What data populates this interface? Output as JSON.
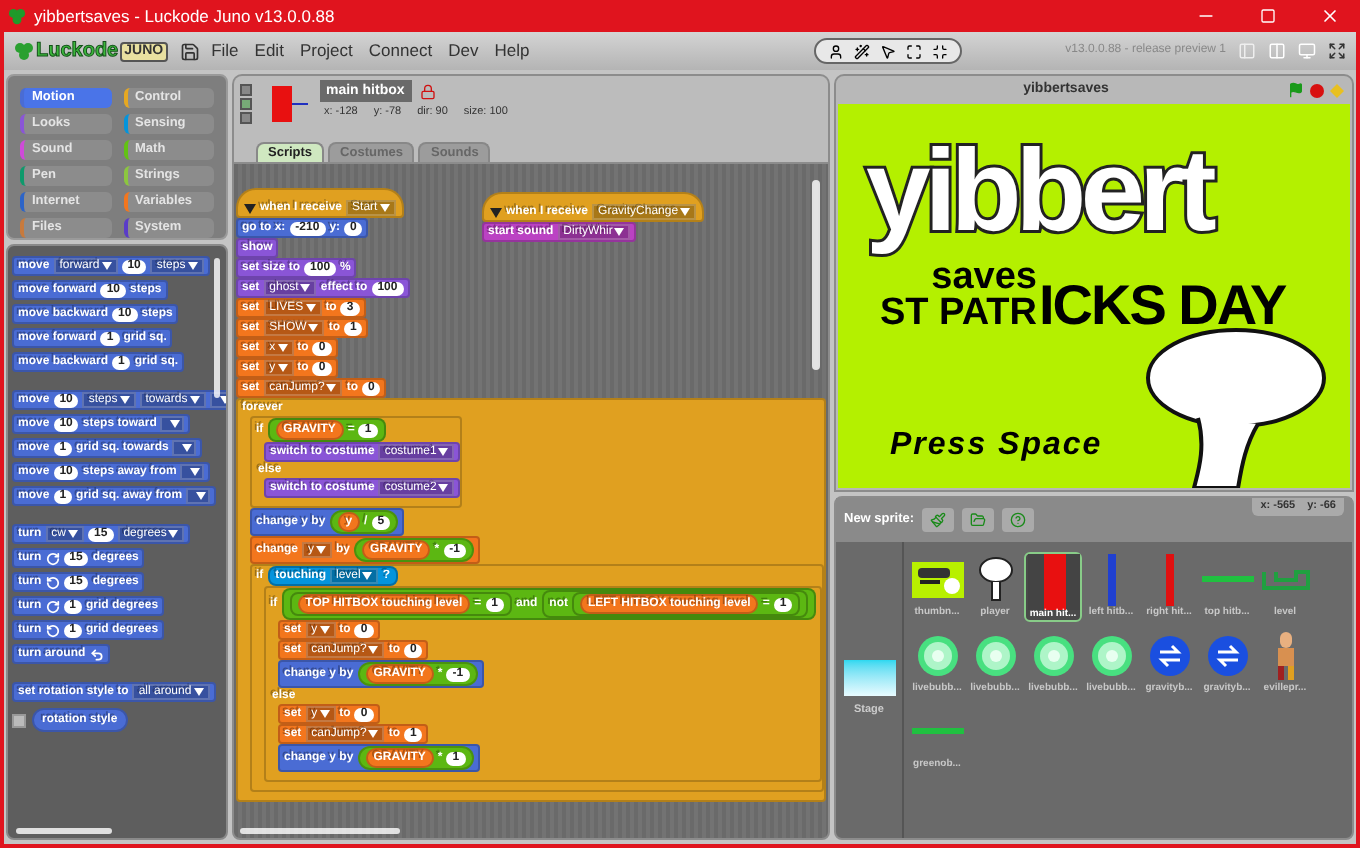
{
  "window": {
    "title": "yibbertsaves - Luckode Juno v13.0.0.88"
  },
  "logo": {
    "word": "Luckode",
    "badge": "JUNO"
  },
  "menu": [
    "File",
    "Edit",
    "Project",
    "Connect",
    "Dev",
    "Help"
  ],
  "version": "v13.0.0.88 - release preview 1",
  "categories": [
    {
      "label": "Motion",
      "color": "#4a6cd4",
      "selected": true
    },
    {
      "label": "Control",
      "color": "#e6a822",
      "selected": false
    },
    {
      "label": "Looks",
      "color": "#8a55d7",
      "selected": false
    },
    {
      "label": "Sensing",
      "color": "#0494dc",
      "selected": false
    },
    {
      "label": "Sound",
      "color": "#cf4ad9",
      "selected": false
    },
    {
      "label": "Math",
      "color": "#62c213",
      "selected": false
    },
    {
      "label": "Pen",
      "color": "#0e9a6c",
      "selected": false
    },
    {
      "label": "Strings",
      "color": "#8cc63f",
      "selected": false
    },
    {
      "label": "Internet",
      "color": "#2c64c8",
      "selected": false
    },
    {
      "label": "Variables",
      "color": "#f3761d",
      "selected": false
    },
    {
      "label": "Files",
      "color": "#c87a3c",
      "selected": false
    },
    {
      "label": "System",
      "color": "#5a3cc8",
      "selected": false
    }
  ],
  "palette": {
    "blocks": [
      {
        "kind": "motion",
        "parts": [
          {
            "kind": "text",
            "text": "move"
          },
          {
            "kind": "menu",
            "text": "forward"
          },
          {
            "kind": "num",
            "text": "10"
          },
          {
            "kind": "menu",
            "text": "steps"
          }
        ]
      },
      {
        "kind": "motion",
        "parts": [
          {
            "kind": "text",
            "text": "move forward"
          },
          {
            "kind": "num",
            "text": "10"
          },
          {
            "kind": "text",
            "text": "steps"
          }
        ]
      },
      {
        "kind": "motion",
        "parts": [
          {
            "kind": "text",
            "text": "move backward"
          },
          {
            "kind": "num",
            "text": "10"
          },
          {
            "kind": "text",
            "text": "steps"
          }
        ]
      },
      {
        "kind": "motion",
        "parts": [
          {
            "kind": "text",
            "text": "move forward"
          },
          {
            "kind": "num",
            "text": "1"
          },
          {
            "kind": "text",
            "text": "grid sq."
          }
        ]
      },
      {
        "kind": "motion",
        "parts": [
          {
            "kind": "text",
            "text": "move backward"
          },
          {
            "kind": "num",
            "text": "1"
          },
          {
            "kind": "text",
            "text": "grid sq."
          }
        ]
      },
      {
        "kind": "motion",
        "gap": true,
        "parts": [
          {
            "kind": "text",
            "text": "move"
          },
          {
            "kind": "num",
            "text": "10"
          },
          {
            "kind": "menu",
            "text": "steps"
          },
          {
            "kind": "menu",
            "text": "towards"
          },
          {
            "kind": "blank"
          }
        ]
      },
      {
        "kind": "motion",
        "parts": [
          {
            "kind": "text",
            "text": "move"
          },
          {
            "kind": "num",
            "text": "10"
          },
          {
            "kind": "text",
            "text": "steps toward"
          },
          {
            "kind": "blank"
          }
        ]
      },
      {
        "kind": "motion",
        "parts": [
          {
            "kind": "text",
            "text": "move"
          },
          {
            "kind": "num",
            "text": "1"
          },
          {
            "kind": "text",
            "text": "grid sq. towards"
          },
          {
            "kind": "blank"
          }
        ]
      },
      {
        "kind": "motion",
        "parts": [
          {
            "kind": "text",
            "text": "move"
          },
          {
            "kind": "num",
            "text": "10"
          },
          {
            "kind": "text",
            "text": "steps away from"
          },
          {
            "kind": "blank"
          }
        ]
      },
      {
        "kind": "motion",
        "parts": [
          {
            "kind": "text",
            "text": "move"
          },
          {
            "kind": "num",
            "text": "1"
          },
          {
            "kind": "text",
            "text": "grid sq. away from"
          },
          {
            "kind": "blank"
          }
        ]
      },
      {
        "kind": "motion",
        "gap": true,
        "parts": [
          {
            "kind": "text",
            "text": "turn"
          },
          {
            "kind": "menu",
            "text": "cw"
          },
          {
            "kind": "num",
            "text": "15"
          },
          {
            "kind": "menu",
            "text": "degrees"
          }
        ]
      },
      {
        "kind": "motion",
        "parts": [
          {
            "kind": "text",
            "text": "turn"
          },
          {
            "kind": "cw"
          },
          {
            "kind": "num",
            "text": "15"
          },
          {
            "kind": "text",
            "text": "degrees"
          }
        ]
      },
      {
        "kind": "motion",
        "parts": [
          {
            "kind": "text",
            "text": "turn"
          },
          {
            "kind": "ccw"
          },
          {
            "kind": "num",
            "text": "15"
          },
          {
            "kind": "text",
            "text": "degrees"
          }
        ]
      },
      {
        "kind": "motion",
        "parts": [
          {
            "kind": "text",
            "text": "turn"
          },
          {
            "kind": "cw"
          },
          {
            "kind": "num",
            "text": "1"
          },
          {
            "kind": "text",
            "text": "grid degrees"
          }
        ]
      },
      {
        "kind": "motion",
        "parts": [
          {
            "kind": "text",
            "text": "turn"
          },
          {
            "kind": "ccw"
          },
          {
            "kind": "num",
            "text": "1"
          },
          {
            "kind": "text",
            "text": "grid degrees"
          }
        ]
      },
      {
        "kind": "motion",
        "parts": [
          {
            "kind": "text",
            "text": "turn around"
          },
          {
            "kind": "around"
          }
        ]
      },
      {
        "kind": "motion",
        "gap": true,
        "parts": [
          {
            "kind": "text",
            "text": "set rotation style to"
          },
          {
            "kind": "menu",
            "text": "all around"
          }
        ]
      },
      {
        "kind": "watcher",
        "checked": false,
        "parts": [
          {
            "kind": "text",
            "text": "rotation style"
          }
        ]
      }
    ]
  },
  "sprite": {
    "name": "main hitbox",
    "locked": true,
    "x": "x: -128",
    "y": "y: -78",
    "dir": "dir: 90",
    "size": "size: 100"
  },
  "tabs": [
    {
      "label": "Scripts",
      "selected": true
    },
    {
      "label": "Costumes",
      "selected": false
    },
    {
      "label": "Sounds",
      "selected": false
    }
  ],
  "scripts": [
    {
      "blocks": [
        {
          "kind": "hat",
          "parts": [
            {
              "kind": "collapse"
            },
            {
              "kind": "text",
              "text": "when I receive"
            },
            {
              "kind": "menu",
              "text": "Start"
            }
          ]
        },
        {
          "kind": "motion",
          "parts": [
            {
              "kind": "text",
              "text": "go to x:"
            },
            {
              "kind": "num",
              "text": "-210"
            },
            {
              "kind": "text",
              "text": "y:"
            },
            {
              "kind": "num",
              "text": "0"
            }
          ]
        },
        {
          "kind": "looks",
          "parts": [
            {
              "kind": "text",
              "text": "show"
            }
          ]
        },
        {
          "kind": "looks",
          "parts": [
            {
              "kind": "text",
              "text": "set size to"
            },
            {
              "kind": "num",
              "text": "100"
            },
            {
              "kind": "text",
              "text": "%"
            }
          ]
        },
        {
          "kind": "looks",
          "parts": [
            {
              "kind": "text",
              "text": "set"
            },
            {
              "kind": "menu",
              "text": "ghost"
            },
            {
              "kind": "text",
              "text": "effect to"
            },
            {
              "kind": "num",
              "text": "100"
            }
          ]
        },
        {
          "kind": "variables",
          "parts": [
            {
              "kind": "text",
              "text": "set"
            },
            {
              "kind": "menu",
              "text": "LIVES"
            },
            {
              "kind": "text",
              "text": "to"
            },
            {
              "kind": "num",
              "text": "3"
            }
          ]
        },
        {
          "kind": "variables",
          "parts": [
            {
              "kind": "text",
              "text": "set"
            },
            {
              "kind": "menu",
              "text": "SHOW"
            },
            {
              "kind": "text",
              "text": "to"
            },
            {
              "kind": "num",
              "text": "1"
            }
          ]
        },
        {
          "kind": "variables",
          "parts": [
            {
              "kind": "text",
              "text": "set"
            },
            {
              "kind": "menu",
              "text": "x"
            },
            {
              "kind": "text",
              "text": "to"
            },
            {
              "kind": "num",
              "text": "0"
            }
          ]
        },
        {
          "kind": "variables",
          "parts": [
            {
              "kind": "text",
              "text": "set"
            },
            {
              "kind": "menu",
              "text": "y"
            },
            {
              "kind": "text",
              "text": "to"
            },
            {
              "kind": "num",
              "text": "0"
            }
          ]
        },
        {
          "kind": "variables",
          "parts": [
            {
              "kind": "text",
              "text": "set"
            },
            {
              "kind": "menu",
              "text": "canJump?"
            },
            {
              "kind": "text",
              "text": "to"
            },
            {
              "kind": "num",
              "text": "0"
            }
          ]
        },
        {
          "kind": "c",
          "parts": [
            {
              "kind": "text",
              "text": "forever"
            }
          ],
          "body": [
            {
              "kind": "c",
              "parts": [
                {
                  "kind": "text",
                  "text": "if"
                },
                {
                  "kind": "cond",
                  "parts": [
                    {
                      "kind": "var",
                      "parts": [
                        {
                          "kind": "text",
                          "text": "GRAVITY"
                        }
                      ]
                    },
                    {
                      "kind": "text",
                      "text": "="
                    },
                    {
                      "kind": "num",
                      "text": "1"
                    }
                  ]
                }
              ],
              "body": [
                {
                  "kind": "looks",
                  "parts": [
                    {
                      "kind": "text",
                      "text": "switch to costume"
                    },
                    {
                      "kind": "menu",
                      "text": "costume1"
                    }
                  ]
                }
              ],
              "else": {
                "label": "else",
                "body": [
                  {
                    "kind": "looks",
                    "parts": [
                      {
                        "kind": "text",
                        "text": "switch to costume"
                      },
                      {
                        "kind": "menu",
                        "text": "costume2"
                      }
                    ]
                  }
                ]
              }
            },
            {
              "kind": "motion",
              "parts": [
                {
                  "kind": "text",
                  "text": "change y by"
                },
                {
                  "kind": "op",
                  "parts": [
                    {
                      "kind": "var",
                      "parts": [
                        {
                          "kind": "text",
                          "text": "y"
                        }
                      ]
                    },
                    {
                      "kind": "text",
                      "text": "/"
                    },
                    {
                      "kind": "num",
                      "text": "5"
                    }
                  ]
                }
              ]
            },
            {
              "kind": "variables",
              "parts": [
                {
                  "kind": "text",
                  "text": "change"
                },
                {
                  "kind": "menu",
                  "text": "y"
                },
                {
                  "kind": "text",
                  "text": "by"
                },
                {
                  "kind": "op",
                  "parts": [
                    {
                      "kind": "var",
                      "parts": [
                        {
                          "kind": "text",
                          "text": "GRAVITY"
                        }
                      ]
                    },
                    {
                      "kind": "text",
                      "text": "*"
                    },
                    {
                      "kind": "num",
                      "text": "-1"
                    }
                  ]
                }
              ]
            },
            {
              "kind": "c",
              "parts": [
                {
                  "kind": "text",
                  "text": "if"
                },
                {
                  "kind": "sense",
                  "parts": [
                    {
                      "kind": "text",
                      "text": "touching"
                    },
                    {
                      "kind": "menu",
                      "text": "level"
                    },
                    {
                      "kind": "text",
                      "text": "?"
                    }
                  ]
                }
              ],
              "body": [
                {
                  "kind": "c",
                  "parts": [
                    {
                      "kind": "text",
                      "text": "if"
                    },
                    {
                      "kind": "cond",
                      "parts": [
                        {
                          "kind": "cond",
                          "parts": [
                            {
                              "kind": "var",
                              "parts": [
                                {
                                  "kind": "text",
                                  "text": "TOP HITBOX touching level"
                                }
                              ]
                            },
                            {
                              "kind": "text",
                              "text": "="
                            },
                            {
                              "kind": "num",
                              "text": "1"
                            }
                          ]
                        },
                        {
                          "kind": "text",
                          "text": "and"
                        },
                        {
                          "kind": "cond",
                          "parts": [
                            {
                              "kind": "text",
                              "text": "not"
                            },
                            {
                              "kind": "cond",
                              "parts": [
                                {
                                  "kind": "var",
                                  "parts": [
                                    {
                                      "kind": "text",
                                      "text": "LEFT HITBOX touching level"
                                    }
                                  ]
                                },
                                {
                                  "kind": "text",
                                  "text": "="
                                },
                                {
                                  "kind": "num",
                                  "text": "1"
                                }
                              ]
                            }
                          ]
                        }
                      ]
                    }
                  ],
                  "body": [
                    {
                      "kind": "variables",
                      "parts": [
                        {
                          "kind": "text",
                          "text": "set"
                        },
                        {
                          "kind": "menu",
                          "text": "y"
                        },
                        {
                          "kind": "text",
                          "text": "to"
                        },
                        {
                          "kind": "num",
                          "text": "0"
                        }
                      ]
                    },
                    {
                      "kind": "variables",
                      "parts": [
                        {
                          "kind": "text",
                          "text": "set"
                        },
                        {
                          "kind": "menu",
                          "text": "canJump?"
                        },
                        {
                          "kind": "text",
                          "text": "to"
                        },
                        {
                          "kind": "num",
                          "text": "0"
                        }
                      ]
                    },
                    {
                      "kind": "motion",
                      "parts": [
                        {
                          "kind": "text",
                          "text": "change y by"
                        },
                        {
                          "kind": "op",
                          "parts": [
                            {
                              "kind": "var",
                              "parts": [
                                {
                                  "kind": "text",
                                  "text": "GRAVITY"
                                }
                              ]
                            },
                            {
                              "kind": "text",
                              "text": "*"
                            },
                            {
                              "kind": "num",
                              "text": "-1"
                            }
                          ]
                        }
                      ]
                    }
                  ],
                  "else": {
                    "label": "else",
                    "body": [
                      {
                        "kind": "variables",
                        "parts": [
                          {
                            "kind": "text",
                            "text": "set"
                          },
                          {
                            "kind": "menu",
                            "text": "y"
                          },
                          {
                            "kind": "text",
                            "text": "to"
                          },
                          {
                            "kind": "num",
                            "text": "0"
                          }
                        ]
                      },
                      {
                        "kind": "variables",
                        "parts": [
                          {
                            "kind": "text",
                            "text": "set"
                          },
                          {
                            "kind": "menu",
                            "text": "canJump?"
                          },
                          {
                            "kind": "text",
                            "text": "to"
                          },
                          {
                            "kind": "num",
                            "text": "1"
                          }
                        ]
                      },
                      {
                        "kind": "motion",
                        "parts": [
                          {
                            "kind": "text",
                            "text": "change y by"
                          },
                          {
                            "kind": "op",
                            "parts": [
                              {
                                "kind": "var",
                                "parts": [
                                  {
                                    "kind": "text",
                                    "text": "GRAVITY"
                                  }
                                ]
                              },
                              {
                                "kind": "text",
                                "text": "*"
                              },
                              {
                                "kind": "num",
                                "text": "1"
                              }
                            ]
                          }
                        ]
                      }
                    ]
                  }
                }
              ]
            }
          ]
        }
      ]
    },
    {
      "blocks": [
        {
          "kind": "hat",
          "parts": [
            {
              "kind": "collapse"
            },
            {
              "kind": "text",
              "text": "when I receive"
            },
            {
              "kind": "menu",
              "text": "GravityChange"
            }
          ]
        },
        {
          "kind": "sound",
          "parts": [
            {
              "kind": "text",
              "text": "start sound"
            },
            {
              "kind": "menu",
              "text": "DirtyWhir"
            }
          ]
        }
      ]
    }
  ],
  "stage": {
    "title": "yibbertsaves",
    "texts": [
      {
        "kind": "logo",
        "text": "yibbert"
      },
      {
        "kind": "small",
        "text": "saves"
      },
      {
        "kind": "small",
        "text": "ST PATR"
      },
      {
        "kind": "big",
        "text": "ICKS DAY"
      },
      {
        "kind": "prompt",
        "text": "Press Space"
      }
    ]
  },
  "corral": {
    "new_sprite_label": "New sprite:",
    "coords": {
      "x": "x: -565",
      "y": "y: -66"
    },
    "stage_label": "Stage",
    "sprites": [
      {
        "name": "thumbn...",
        "kind": "poster",
        "selected": false
      },
      {
        "name": "player",
        "kind": "blob",
        "selected": false
      },
      {
        "name": "main hit...",
        "kind": "redbox",
        "selected": true
      },
      {
        "name": "left hitb...",
        "kind": "bluebar",
        "selected": false
      },
      {
        "name": "right hit...",
        "kind": "redbar",
        "selected": false
      },
      {
        "name": "top hitb...",
        "kind": "line",
        "selected": false
      },
      {
        "name": "level",
        "kind": "level",
        "selected": false
      },
      {
        "name": "livebubb...",
        "kind": "bubble",
        "selected": false
      },
      {
        "name": "livebubb...",
        "kind": "bubble",
        "selected": false
      },
      {
        "name": "livebubb...",
        "kind": "bubble",
        "selected": false
      },
      {
        "name": "livebubb...",
        "kind": "bubble",
        "selected": false
      },
      {
        "name": "gravityb...",
        "kind": "gravity",
        "selected": false
      },
      {
        "name": "gravityb...",
        "kind": "gravity",
        "selected": false
      },
      {
        "name": "evillepr...",
        "kind": "figure",
        "selected": false
      },
      {
        "name": "greenob...",
        "kind": "line",
        "selected": false
      }
    ]
  }
}
